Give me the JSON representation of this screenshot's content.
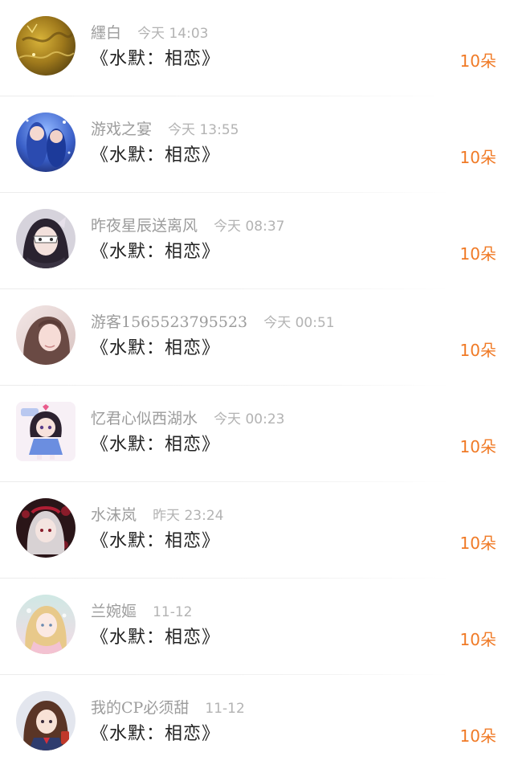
{
  "colors": {
    "accent": "#f07a26",
    "username": "#9c9c9c",
    "timestamp": "#b3b3b3",
    "title": "#222222"
  },
  "gifts": [
    {
      "user": "纆白",
      "time": "今天 14:03",
      "title": "《水默：相恋》",
      "count": "10朵",
      "avatar_icon": "golden-texture-avatar"
    },
    {
      "user": "游戏之宴",
      "time": "今天 13:55",
      "title": "《水默：相恋》",
      "count": "10朵",
      "avatar_icon": "blue-anime-couple-avatar"
    },
    {
      "user": "昨夜星辰送离风",
      "time": "今天 08:37",
      "title": "《水默：相恋》",
      "count": "10朵",
      "avatar_icon": "masked-anime-girl-avatar"
    },
    {
      "user": "游客1565523795523",
      "time": "今天 00:51",
      "title": "《水默：相恋》",
      "count": "10朵",
      "avatar_icon": "girl-photo-avatar"
    },
    {
      "user": "忆君心似西湖水",
      "time": "今天 00:23",
      "title": "《水默：相恋》",
      "count": "10朵",
      "avatar_icon": "chibi-girl-avatar"
    },
    {
      "user": "水沫岚",
      "time": "昨天 23:24",
      "title": "《水默：相恋》",
      "count": "10朵",
      "avatar_icon": "dark-anime-girl-avatar"
    },
    {
      "user": "兰婉嫗",
      "time": "11-12",
      "title": "《水默：相恋》",
      "count": "10朵",
      "avatar_icon": "pastel-anime-girl-avatar"
    },
    {
      "user": "我的CP必须甜",
      "time": "11-12",
      "title": "《水默：相恋》",
      "count": "10朵",
      "avatar_icon": "brown-hair-anime-girl-avatar"
    }
  ]
}
